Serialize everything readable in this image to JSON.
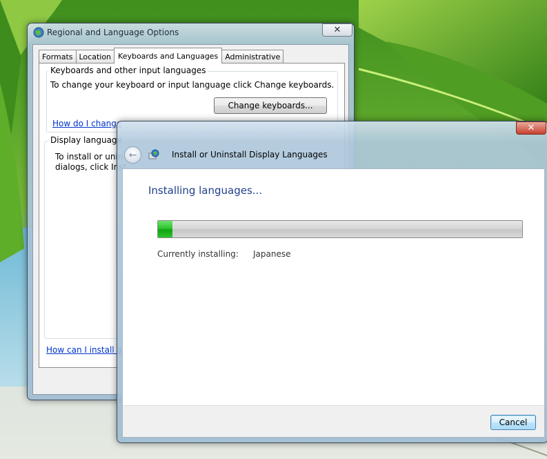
{
  "regional": {
    "title": "Regional and Language Options",
    "close_glyph": "✕",
    "tabs": [
      "Formats",
      "Location",
      "Keyboards and Languages",
      "Administrative"
    ],
    "keyboards_group": {
      "title": "Keyboards and other input languages",
      "description": "To change your keyboard or input language click Change keyboards.",
      "button": "Change keyboards...",
      "link": "How do I change"
    },
    "display_group": {
      "title": "Display language",
      "description_line1": "To install or unin",
      "description_line2": "dialogs, click Inst"
    },
    "bottom_link": "How can I install a"
  },
  "install": {
    "close_glyph": "✕",
    "back_glyph": "←",
    "title": "Install or Uninstall Display Languages",
    "heading": "Installing languages...",
    "progress_fraction": 0.04,
    "currently_label": "Currently installing:",
    "currently_value": "Japanese",
    "cancel_label": "Cancel"
  },
  "colors": {
    "link": "#0033cc",
    "heading": "#1e3f88",
    "progress": "#1fb51f",
    "close_button_red": "#c8402f"
  }
}
